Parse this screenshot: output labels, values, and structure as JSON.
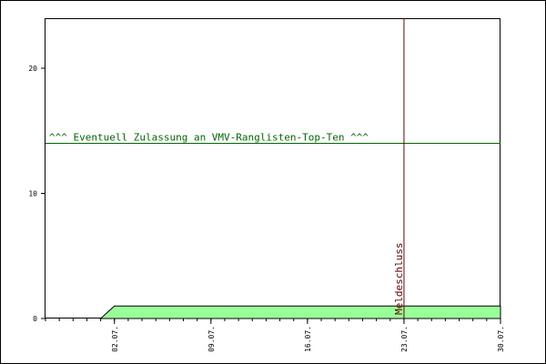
{
  "chart_data": {
    "type": "area",
    "title": "",
    "xlabel": "",
    "ylabel": "",
    "x_ticks": [
      "02.07.",
      "09.07.",
      "16.07.",
      "23.07.",
      "30.07."
    ],
    "x_tick_days": [
      2,
      9,
      16,
      23,
      30
    ],
    "xlim_days": [
      -3,
      30
    ],
    "ylim": [
      0,
      24
    ],
    "y_ticks": [
      0,
      10,
      20
    ],
    "grid": false,
    "series": [
      {
        "values_day": [
          1,
          2,
          30
        ],
        "values": [
          0,
          1,
          1
        ],
        "color": "#99ff99",
        "stroke": "#000000"
      }
    ],
    "annotations": [
      {
        "kind": "hline",
        "y": 14,
        "label": "^^^ Eventuell Zulassung an VMV-Ranglisten-Top-Ten ^^^",
        "color": "#006600"
      },
      {
        "kind": "vline",
        "x_day": 23,
        "label": "Meldeschluss",
        "color": "#660000"
      }
    ]
  }
}
